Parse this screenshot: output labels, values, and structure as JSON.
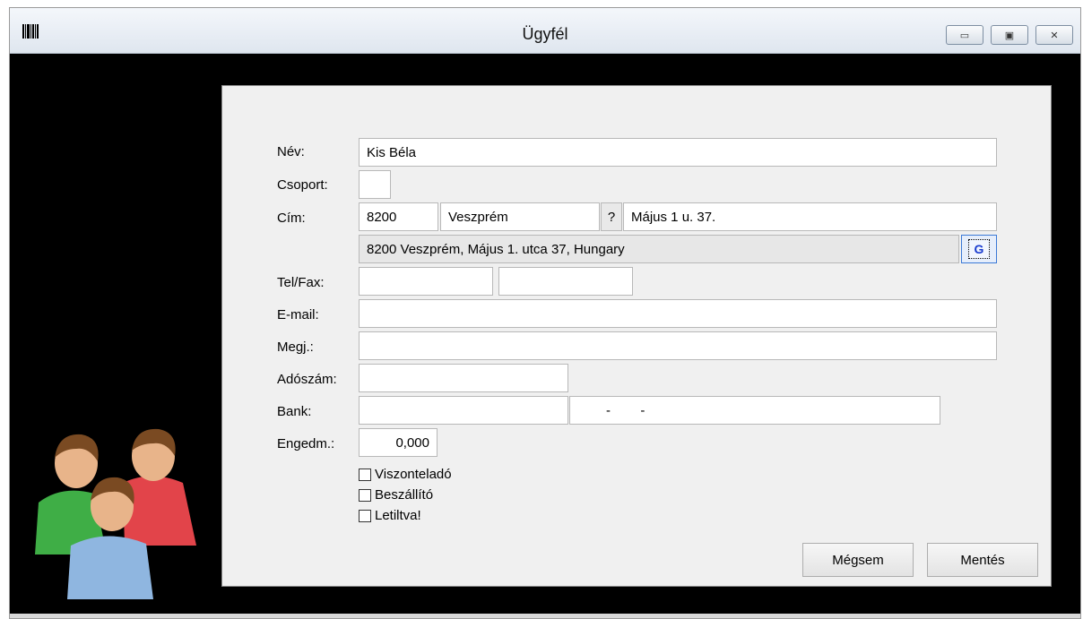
{
  "window": {
    "title": "Ügyfél",
    "app_icon": "barcode-icon"
  },
  "controls": {
    "minimize": "▭",
    "maximize": "▣",
    "close": "✕"
  },
  "form": {
    "labels": {
      "name": "Név:",
      "group": "Csoport:",
      "address": "Cím:",
      "telfax": "Tel/Fax:",
      "email": "E-mail:",
      "note": "Megj.:",
      "tax": "Adószám:",
      "bank": "Bank:",
      "discount": "Engedm.:"
    },
    "values": {
      "name": "Kis Béla",
      "group": "",
      "zip": "8200",
      "city": "Veszprém",
      "question": "?",
      "street": "Május 1 u. 37.",
      "geocoded": "8200 Veszprém, Május 1. utca 37, Hungary",
      "geocode_button": "G",
      "tel": "",
      "fax": "",
      "email": "",
      "note": "",
      "tax": "",
      "bank_name": "",
      "bank_account": "-        -",
      "discount": "0,000"
    },
    "checkboxes": [
      {
        "label": "Viszonteladó",
        "checked": false
      },
      {
        "label": "Beszállító",
        "checked": false
      },
      {
        "label": "Letiltva!",
        "checked": false
      }
    ],
    "buttons": {
      "cancel": "Mégsem",
      "save": "Mentés"
    }
  },
  "colors": {
    "window_bg": "#000000",
    "panel_bg": "#f0f0f0",
    "accent": "#3a78d6"
  }
}
